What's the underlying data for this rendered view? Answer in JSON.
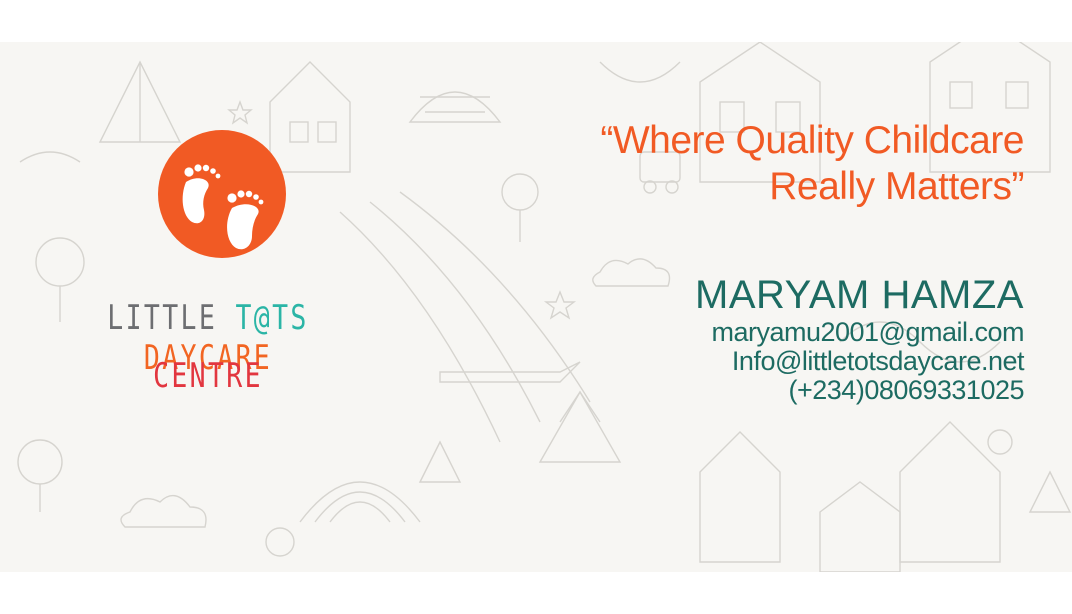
{
  "brand": {
    "word1": "LITTLE",
    "word2": "T@TS",
    "word3": "DAYCARE",
    "line2": "CENTRE"
  },
  "tagline": {
    "line1": "“Where Quality Childcare",
    "line2": "Really Matters”"
  },
  "contact": {
    "name": "MARYAM HAMZA",
    "email1": "maryamu2001@gmail.com",
    "email2": "Info@littletotsdaycare.net",
    "phone": "(+234)08069331025"
  },
  "colors": {
    "logo_orange": "#f15a24",
    "brand_grey": "#6d6e71",
    "brand_teal": "#2bb5a6",
    "brand_orange": "#f26522",
    "brand_red": "#e2363f",
    "contact_teal": "#1d6b62"
  },
  "icons": {
    "logo": "footprints-icon"
  }
}
